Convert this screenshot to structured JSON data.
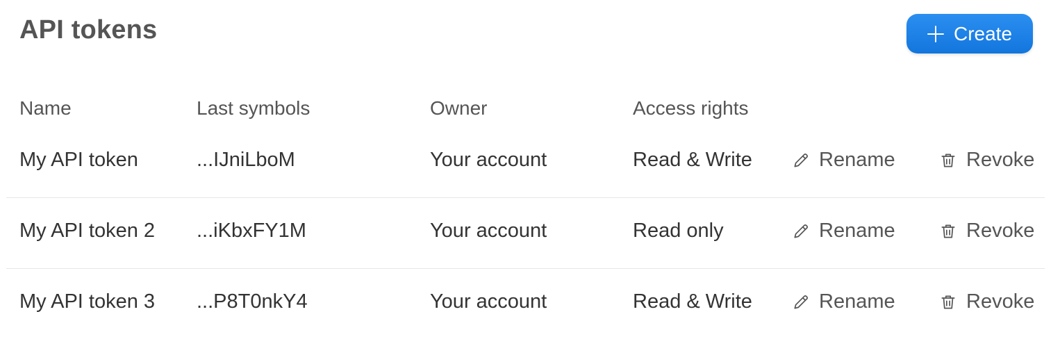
{
  "header": {
    "title": "API tokens",
    "create_label": "Create",
    "create_icon": "plus-icon",
    "accent_color": "#1a7ee3"
  },
  "table": {
    "columns": {
      "name": "Name",
      "last_symbols": "Last symbols",
      "owner": "Owner",
      "access_rights": "Access rights"
    },
    "rows": [
      {
        "name": "My API token",
        "last_symbols": "...IJniLboM",
        "owner": "Your account",
        "access": "Read & Write",
        "rename_label": "Rename",
        "revoke_label": "Revoke"
      },
      {
        "name": "My API token 2",
        "last_symbols": "...iKbxFY1M",
        "owner": "Your account",
        "access": "Read only",
        "rename_label": "Rename",
        "revoke_label": "Revoke"
      },
      {
        "name": "My API token 3",
        "last_symbols": "...P8T0nkY4",
        "owner": "Your account",
        "access": "Read & Write",
        "rename_label": "Rename",
        "revoke_label": "Revoke"
      }
    ],
    "action_icons": {
      "rename": "pencil-icon",
      "revoke": "trash-icon"
    }
  }
}
